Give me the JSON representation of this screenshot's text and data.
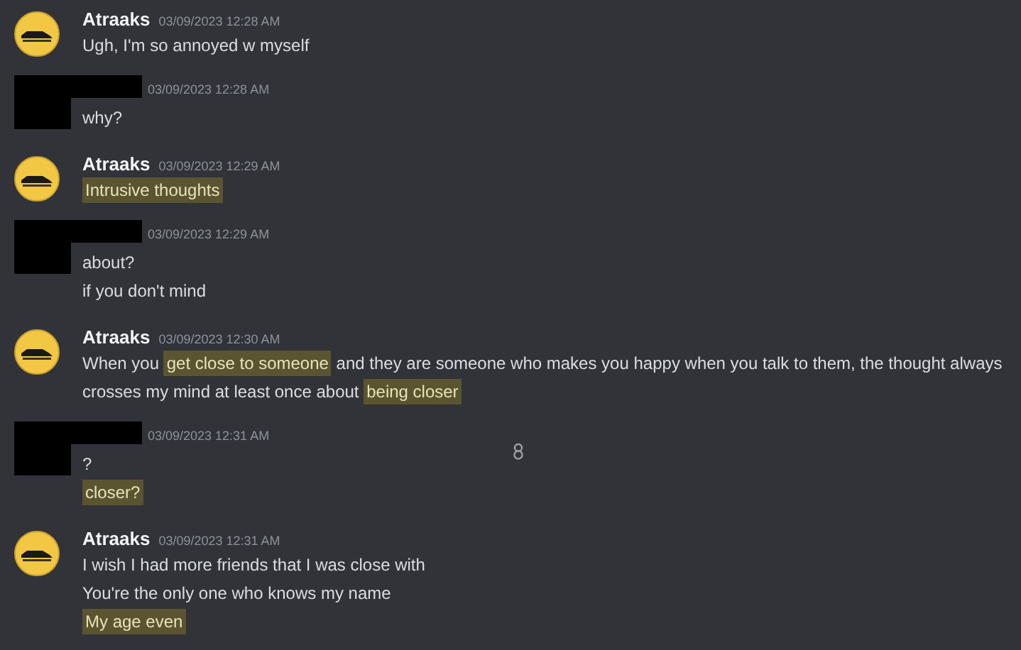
{
  "messages": [
    {
      "author": {
        "name": "Atraaks",
        "redacted": false
      },
      "timestamp": "03/09/2023 12:28 AM",
      "lines": [
        [
          {
            "text": "Ugh, I'm so annoyed w myself",
            "highlighted": false
          }
        ]
      ]
    },
    {
      "author": {
        "redacted": true
      },
      "timestamp": "03/09/2023 12:28 AM",
      "lines": [
        [
          {
            "text": "why?",
            "highlighted": false
          }
        ]
      ]
    },
    {
      "author": {
        "name": "Atraaks",
        "redacted": false
      },
      "timestamp": "03/09/2023 12:29 AM",
      "lines": [
        [
          {
            "text": "Intrusive thoughts",
            "highlighted": true
          }
        ]
      ]
    },
    {
      "author": {
        "redacted": true
      },
      "timestamp": "03/09/2023 12:29 AM",
      "lines": [
        [
          {
            "text": "about?",
            "highlighted": false
          }
        ],
        [
          {
            "text": "if you don't mind",
            "highlighted": false
          }
        ]
      ]
    },
    {
      "author": {
        "name": "Atraaks",
        "redacted": false
      },
      "timestamp": "03/09/2023 12:30 AM",
      "lines": [
        [
          {
            "text": "When you ",
            "highlighted": false
          },
          {
            "text": "get close to someone",
            "highlighted": true
          },
          {
            "text": " and they are someone who makes you happy when you talk to them, the thought always crosses my mind at least once about ",
            "highlighted": false
          },
          {
            "text": "being closer",
            "highlighted": true
          }
        ]
      ]
    },
    {
      "author": {
        "redacted": true
      },
      "timestamp": "03/09/2023 12:31 AM",
      "lines": [
        [
          {
            "text": "?",
            "highlighted": false
          }
        ],
        [
          {
            "text": "closer?",
            "highlighted": true
          }
        ]
      ]
    },
    {
      "author": {
        "name": "Atraaks",
        "redacted": false
      },
      "timestamp": "03/09/2023 12:31 AM",
      "lines": [
        [
          {
            "text": "I wish I had more friends that I was close with",
            "highlighted": false
          }
        ],
        [
          {
            "text": "You're the only one who knows my name",
            "highlighted": false
          }
        ],
        [
          {
            "text": "My age even",
            "highlighted": true
          }
        ]
      ]
    }
  ]
}
